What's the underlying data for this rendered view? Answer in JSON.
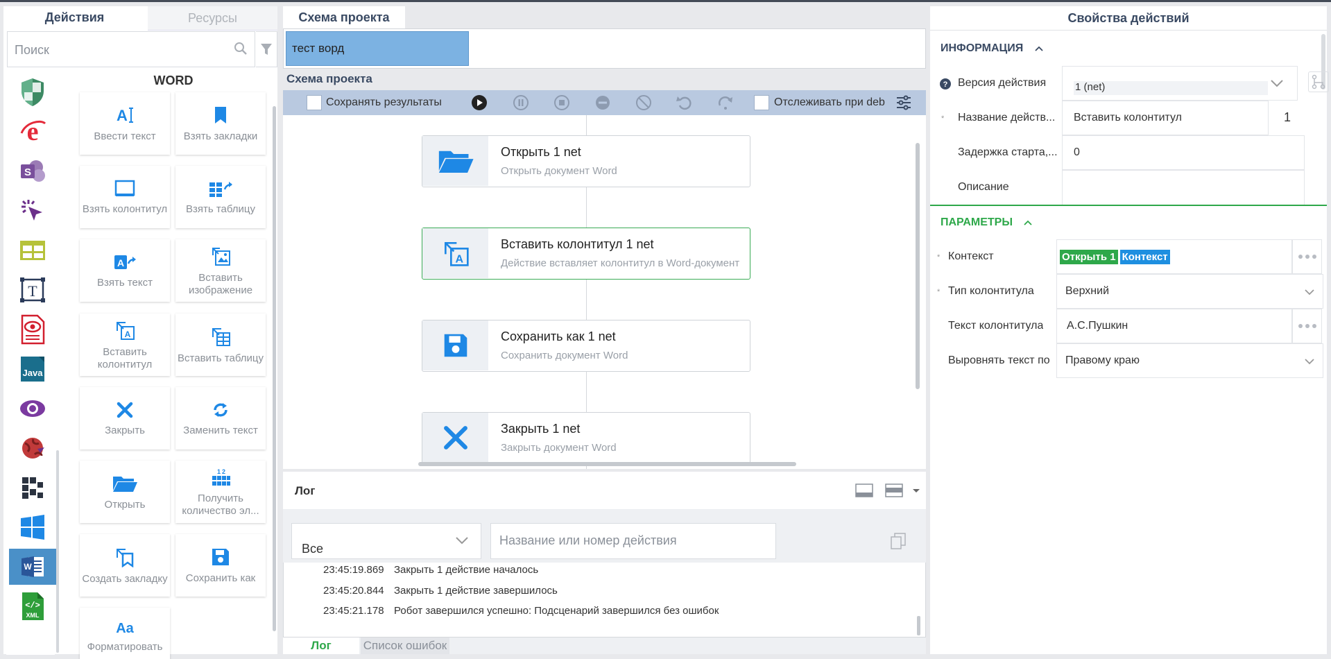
{
  "left": {
    "tabs": [
      "Действия",
      "Ресурсы"
    ],
    "search_placeholder": "Поиск",
    "palette_title": "WORD",
    "icon_categories": [
      "shield-icon",
      "ie-icon",
      "sharepoint-icon",
      "cursor-click-icon",
      "table-grid-icon",
      "text-frame-icon",
      "pdf-eye-icon",
      "java-icon",
      "eye-icon",
      "globe-icon",
      "pixel-icon",
      "windows-icon",
      "word-icon",
      "xml-icon"
    ],
    "tiles": [
      {
        "label": "Ввести текст",
        "icon": "type-text-icon"
      },
      {
        "label": "Взять закладки",
        "icon": "bookmark-icon"
      },
      {
        "label": "Взять колонтитул",
        "icon": "header-icon"
      },
      {
        "label": "Взять таблицу",
        "icon": "table-get-icon"
      },
      {
        "label": "Взять текст",
        "icon": "text-get-icon"
      },
      {
        "label": "Вставить изображение",
        "icon": "insert-image-icon"
      },
      {
        "label": "Вставить колонтитул",
        "icon": "insert-header-icon"
      },
      {
        "label": "Вставить таблицу",
        "icon": "insert-table-icon"
      },
      {
        "label": "Закрыть",
        "icon": "close-icon"
      },
      {
        "label": "Заменить текст",
        "icon": "replace-icon"
      },
      {
        "label": "Открыть",
        "icon": "folder-open-icon"
      },
      {
        "label": "Получить количество эл...",
        "icon": "count-icon"
      },
      {
        "label": "Создать закладку",
        "icon": "create-bookmark-icon"
      },
      {
        "label": "Сохранить как",
        "icon": "save-icon"
      },
      {
        "label": "Форматировать",
        "icon": "format-icon"
      }
    ]
  },
  "middle": {
    "tab": "Схема проекта",
    "project_tab": "тест ворд",
    "schema_label": "Схема проекта",
    "toolbar": {
      "save_results": "Сохранять результаты",
      "track_debug": "Отслеживать при deb"
    },
    "cards": [
      {
        "title": "Открыть  1  net",
        "subtitle": "Открыть документ Word",
        "icon": "folder-open-icon",
        "selected": false
      },
      {
        "title": "Вставить колонтитул  1  net",
        "subtitle": "Действие вставляет колонтитул в Word-документ",
        "icon": "insert-header-icon",
        "selected": true
      },
      {
        "title": "Сохранить как  1  net",
        "subtitle": "Сохранить документ Word",
        "icon": "save-icon",
        "selected": false
      },
      {
        "title": "Закрыть  1  net",
        "subtitle": "Закрыть документ Word",
        "icon": "close-icon",
        "selected": false
      }
    ],
    "log": {
      "title": "Лог",
      "filter_value": "Все",
      "search_placeholder": "Название или номер действия",
      "rows": [
        {
          "time": "23:45:19.869",
          "text": "Закрыть 1 действие началось"
        },
        {
          "time": "23:45:20.844",
          "text": "Закрыть 1 действие завершилось"
        },
        {
          "time": "23:45:21.178",
          "text": "Робот завершился успешно: Подсценарий завершился без ошибок"
        }
      ],
      "tabs": [
        "Лог",
        "Список ошибок"
      ]
    }
  },
  "right": {
    "title": "Свойства действий",
    "info_section": "ИНФОРМАЦИЯ",
    "params_section": "ПАРАМЕТРЫ",
    "info": {
      "version_label": "Версия действия",
      "version_value": "1 (net)",
      "name_label": "Название действ...",
      "name_value": "Вставить колонтитул",
      "name_number": "1",
      "delay_label": "Задержка старта,...",
      "delay_value": "0",
      "desc_label": "Описание",
      "desc_value": ""
    },
    "params": {
      "context_label": "Контекст",
      "context_chip1": "Открыть 1",
      "context_chip2": "Контекст",
      "type_label": "Тип колонтитула",
      "type_value": "Верхний",
      "text_label": "Текст колонтитула",
      "text_value": "А.С.Пушкин",
      "align_label": "Выровнять текст по",
      "align_value": "Правому краю"
    },
    "colors": {
      "chip_green": "#2ea84a",
      "chip_blue": "#1e8fe0",
      "section_green": "#2ea84a",
      "accent_blue": "#1e88e5"
    }
  }
}
